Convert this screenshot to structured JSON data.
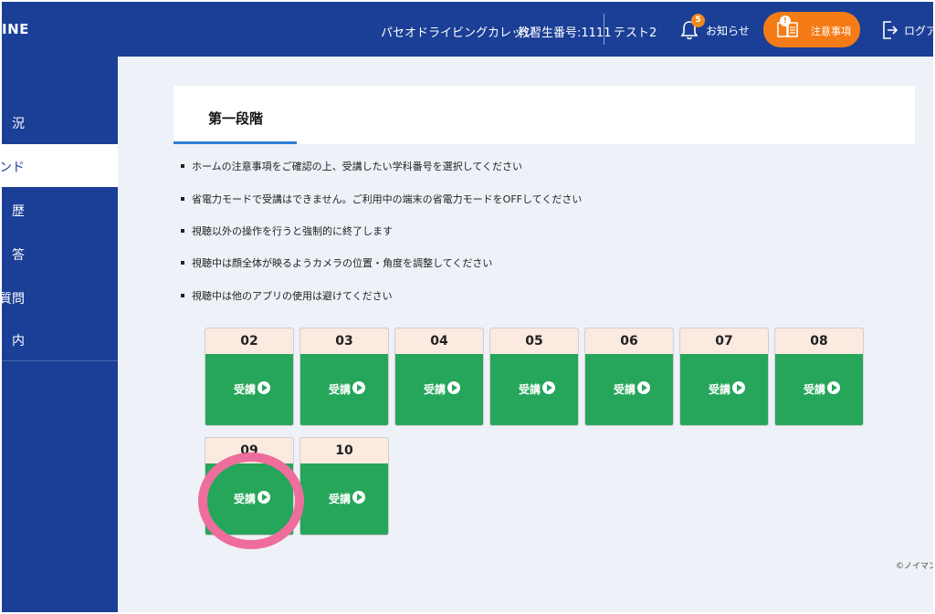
{
  "header": {
    "brand": "INE",
    "school": "パセオドライビングカレッジ",
    "student_no": "教習生番号:1111",
    "user": "テスト2",
    "news_badge": "5",
    "news_label": "お知らせ",
    "notice_badge": "!",
    "notice_label": "注意事項",
    "logout_label": "ログア"
  },
  "sidebar": {
    "items": [
      {
        "label": "況"
      },
      {
        "label": "マンド"
      },
      {
        "label": "歴"
      },
      {
        "label": "答"
      },
      {
        "label": "る質問"
      },
      {
        "label": "内"
      }
    ]
  },
  "main": {
    "title": "第一段階",
    "notes": [
      "ホームの注意事項をご確認の上、受講したい学科番号を選択してください",
      "省電力モードで受講はできません。ご利用中の端末の省電力モードをOFFしてください",
      "視聴以外の操作を行うと強制的に終了します",
      "視聴中は顔全体が映るようカメラの位置・角度を調整してください",
      "視聴中は他のアプリの使用は避けてください"
    ],
    "tiles": [
      {
        "num": "02",
        "button": "受講"
      },
      {
        "num": "03",
        "button": "受講"
      },
      {
        "num": "04",
        "button": "受講"
      },
      {
        "num": "05",
        "button": "受講"
      },
      {
        "num": "06",
        "button": "受講"
      },
      {
        "num": "07",
        "button": "受講"
      },
      {
        "num": "08",
        "button": "受講"
      },
      {
        "num": "09",
        "button": "受講"
      },
      {
        "num": "10",
        "button": "受講"
      }
    ],
    "copyright": "©ノイマン"
  },
  "colors": {
    "header_bg": "#1b3f96",
    "notice_orange": "#f47b16",
    "tile_green": "#26a65b",
    "tile_header": "#fbeae0",
    "highlight_pink": "#ee6d9c",
    "accent_blue": "#2f7fd6"
  }
}
